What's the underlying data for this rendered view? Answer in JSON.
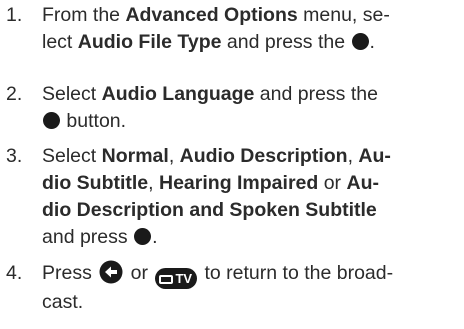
{
  "steps": [
    {
      "num": "1.",
      "lines": [
        {
          "a": "From the ",
          "b": "Advanced Options",
          "c": " menu, se-"
        },
        {
          "a": "lect ",
          "b": "Audio File Type",
          "c": " and press the "
        }
      ]
    },
    {
      "num": "2.",
      "lines": [
        {
          "a": "Select ",
          "b": "Audio Language",
          "c": " and press the"
        },
        {
          "a": " button."
        }
      ]
    },
    {
      "num": "3.",
      "lines": [
        {
          "a": "Select ",
          "b1": "Normal",
          "s1": ", ",
          "b2": "Audio Description",
          "s2": ", ",
          "b3": "Au-"
        },
        {
          "b1": "dio Subtitle",
          "s1": ", ",
          "b2": "Hearing Impaired",
          "s2": " or ",
          "b3": "Au-"
        },
        {
          "b": "dio Description and Spoken Subtitle"
        },
        {
          "a": "and press "
        }
      ]
    },
    {
      "num": "4.",
      "lines": [
        {
          "a": "Press ",
          "or": " or ",
          "c": " to return to the broad-"
        },
        {
          "a": "cast."
        }
      ]
    }
  ],
  "icons": {
    "ok_button": "ok-button-icon",
    "back_button": "back-arrow-icon",
    "tv_button": "tv-button-icon",
    "tv_label": "TV"
  },
  "colors": {
    "text": "#2b2b2b",
    "icon": "#1a1a1a"
  }
}
